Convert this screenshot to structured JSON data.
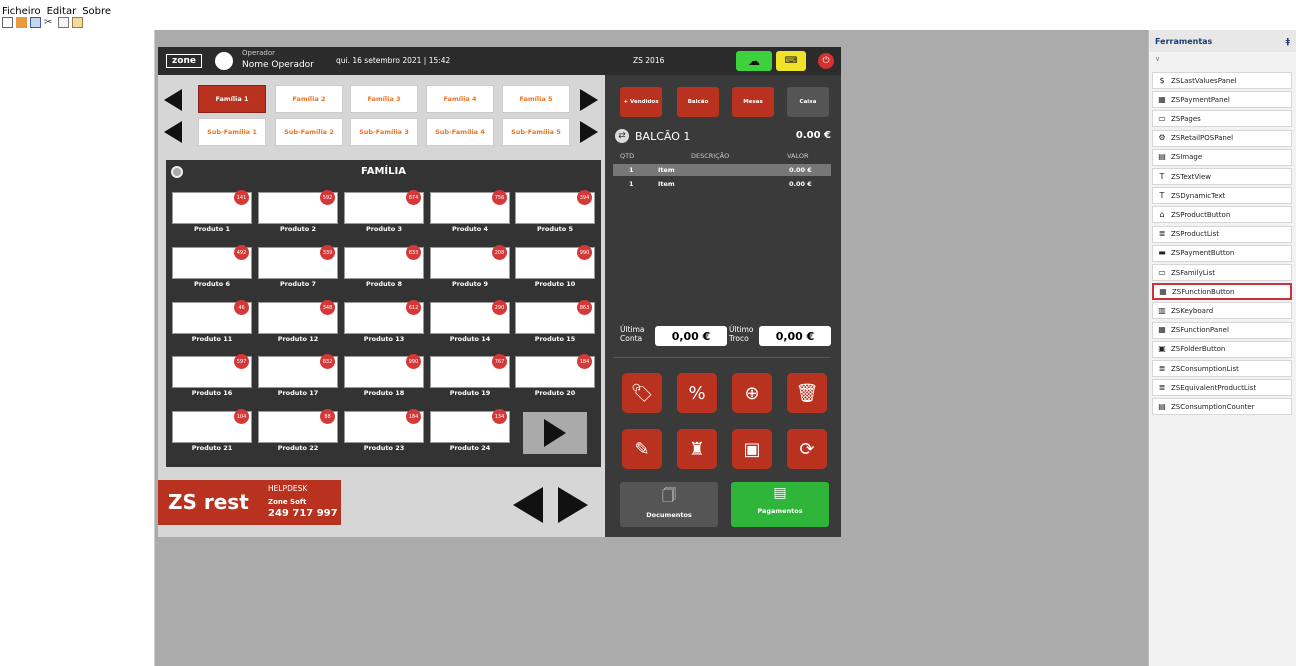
{
  "menubar": {
    "items": [
      "Ficheiro",
      "Editar",
      "Sobre"
    ]
  },
  "toolbox": {
    "title": "Ferramentas",
    "pin": " ‡",
    "items": [
      {
        "label": "ZSLastValuesPanel",
        "icon": "dollar-icon"
      },
      {
        "label": "ZSPaymentPanel",
        "icon": "panel-icon"
      },
      {
        "label": "ZSPages",
        "icon": "pages-icon"
      },
      {
        "label": "ZSRetailPOSPanel",
        "icon": "gear-icon"
      },
      {
        "label": "ZSImage",
        "icon": "image-icon"
      },
      {
        "label": "ZSTextView",
        "icon": "text-icon"
      },
      {
        "label": "ZSDynamicText",
        "icon": "text-icon"
      },
      {
        "label": "ZSProductButton",
        "icon": "product-icon"
      },
      {
        "label": "ZSProductList",
        "icon": "list-icon"
      },
      {
        "label": "ZSPaymentButton",
        "icon": "payment-icon"
      },
      {
        "label": "ZSFamilyList",
        "icon": "family-icon"
      },
      {
        "label": "ZSFunctionButton",
        "icon": "function-icon"
      },
      {
        "label": "ZSKeyboard",
        "icon": "keyboard-icon"
      },
      {
        "label": "ZSFunctionPanel",
        "icon": "panel-icon"
      },
      {
        "label": "ZSFolderButton",
        "icon": "folder-icon"
      },
      {
        "label": "ZSConsumptionList",
        "icon": "list-icon"
      },
      {
        "label": "ZSEquivalentProductList",
        "icon": "list-icon"
      },
      {
        "label": "ZSConsumptionCounter",
        "icon": "counter-icon"
      }
    ],
    "selected_index": 11
  },
  "pos": {
    "logo": "zone",
    "operator_label": "Operador",
    "operator_name": "Nome Operador",
    "datetime": "qui. 16 setembro 2021 | 15:42",
    "app_name": "ZS 2016",
    "families": [
      "Família 1",
      "Família 2",
      "Família 3",
      "Família 4",
      "Família 5"
    ],
    "subfamilies": [
      "Sub-Família 1",
      "Sub-Família 2",
      "Sub-Família 3",
      "Sub-Família 4",
      "Sub-Família 5"
    ],
    "product_panel_title": "FAMÍLIA",
    "products": [
      {
        "name": "Produto 1",
        "badge": "141"
      },
      {
        "name": "Produto 2",
        "badge": "592"
      },
      {
        "name": "Produto 3",
        "badge": "874"
      },
      {
        "name": "Produto 4",
        "badge": "756"
      },
      {
        "name": "Produto 5",
        "badge": "394"
      },
      {
        "name": "Produto 6",
        "badge": "492"
      },
      {
        "name": "Produto 7",
        "badge": "339"
      },
      {
        "name": "Produto 8",
        "badge": "833"
      },
      {
        "name": "Produto 9",
        "badge": "208"
      },
      {
        "name": "Produto 10",
        "badge": "990"
      },
      {
        "name": "Produto 11",
        "badge": "46"
      },
      {
        "name": "Produto 12",
        "badge": "348"
      },
      {
        "name": "Produto 13",
        "badge": "612"
      },
      {
        "name": "Produto 14",
        "badge": "290"
      },
      {
        "name": "Produto 15",
        "badge": "863"
      },
      {
        "name": "Produto 16",
        "badge": "597"
      },
      {
        "name": "Produto 17",
        "badge": "832"
      },
      {
        "name": "Produto 18",
        "badge": "990"
      },
      {
        "name": "Produto 19",
        "badge": "767"
      },
      {
        "name": "Produto 20",
        "badge": "184"
      },
      {
        "name": "Produto 21",
        "badge": "104"
      },
      {
        "name": "Produto 22",
        "badge": "88"
      },
      {
        "name": "Produto 23",
        "badge": "184"
      },
      {
        "name": "Produto 24",
        "badge": "134"
      }
    ],
    "helpdesk": {
      "brand": "ZS rest",
      "label": "HELPDESK",
      "company": "Zone Soft",
      "phone": "249 717 997"
    },
    "order_buttons": [
      "+ Vendidos",
      "Balcão",
      "Mesas",
      "Caixa"
    ],
    "order": {
      "title": "BALCÃO 1",
      "total": "0.00 €",
      "col_qty": "QTD",
      "col_desc": "DESCRIÇÃO",
      "col_value": "VALOR",
      "lines": [
        {
          "qty": "1",
          "desc": "Item",
          "value": "0.00 €"
        },
        {
          "qty": "1",
          "desc": "Item",
          "value": "0.00 €"
        }
      ]
    },
    "last_account_label": "Última Conta",
    "last_account_value": "0,00 €",
    "last_change_label": "Último Troco",
    "last_change_value": "0,00 €",
    "documents_label": "Documentos",
    "payments_label": "Pagamentos",
    "colors": {
      "accent": "#b8321f",
      "green": "#2fb53a",
      "dark": "#333333"
    }
  }
}
